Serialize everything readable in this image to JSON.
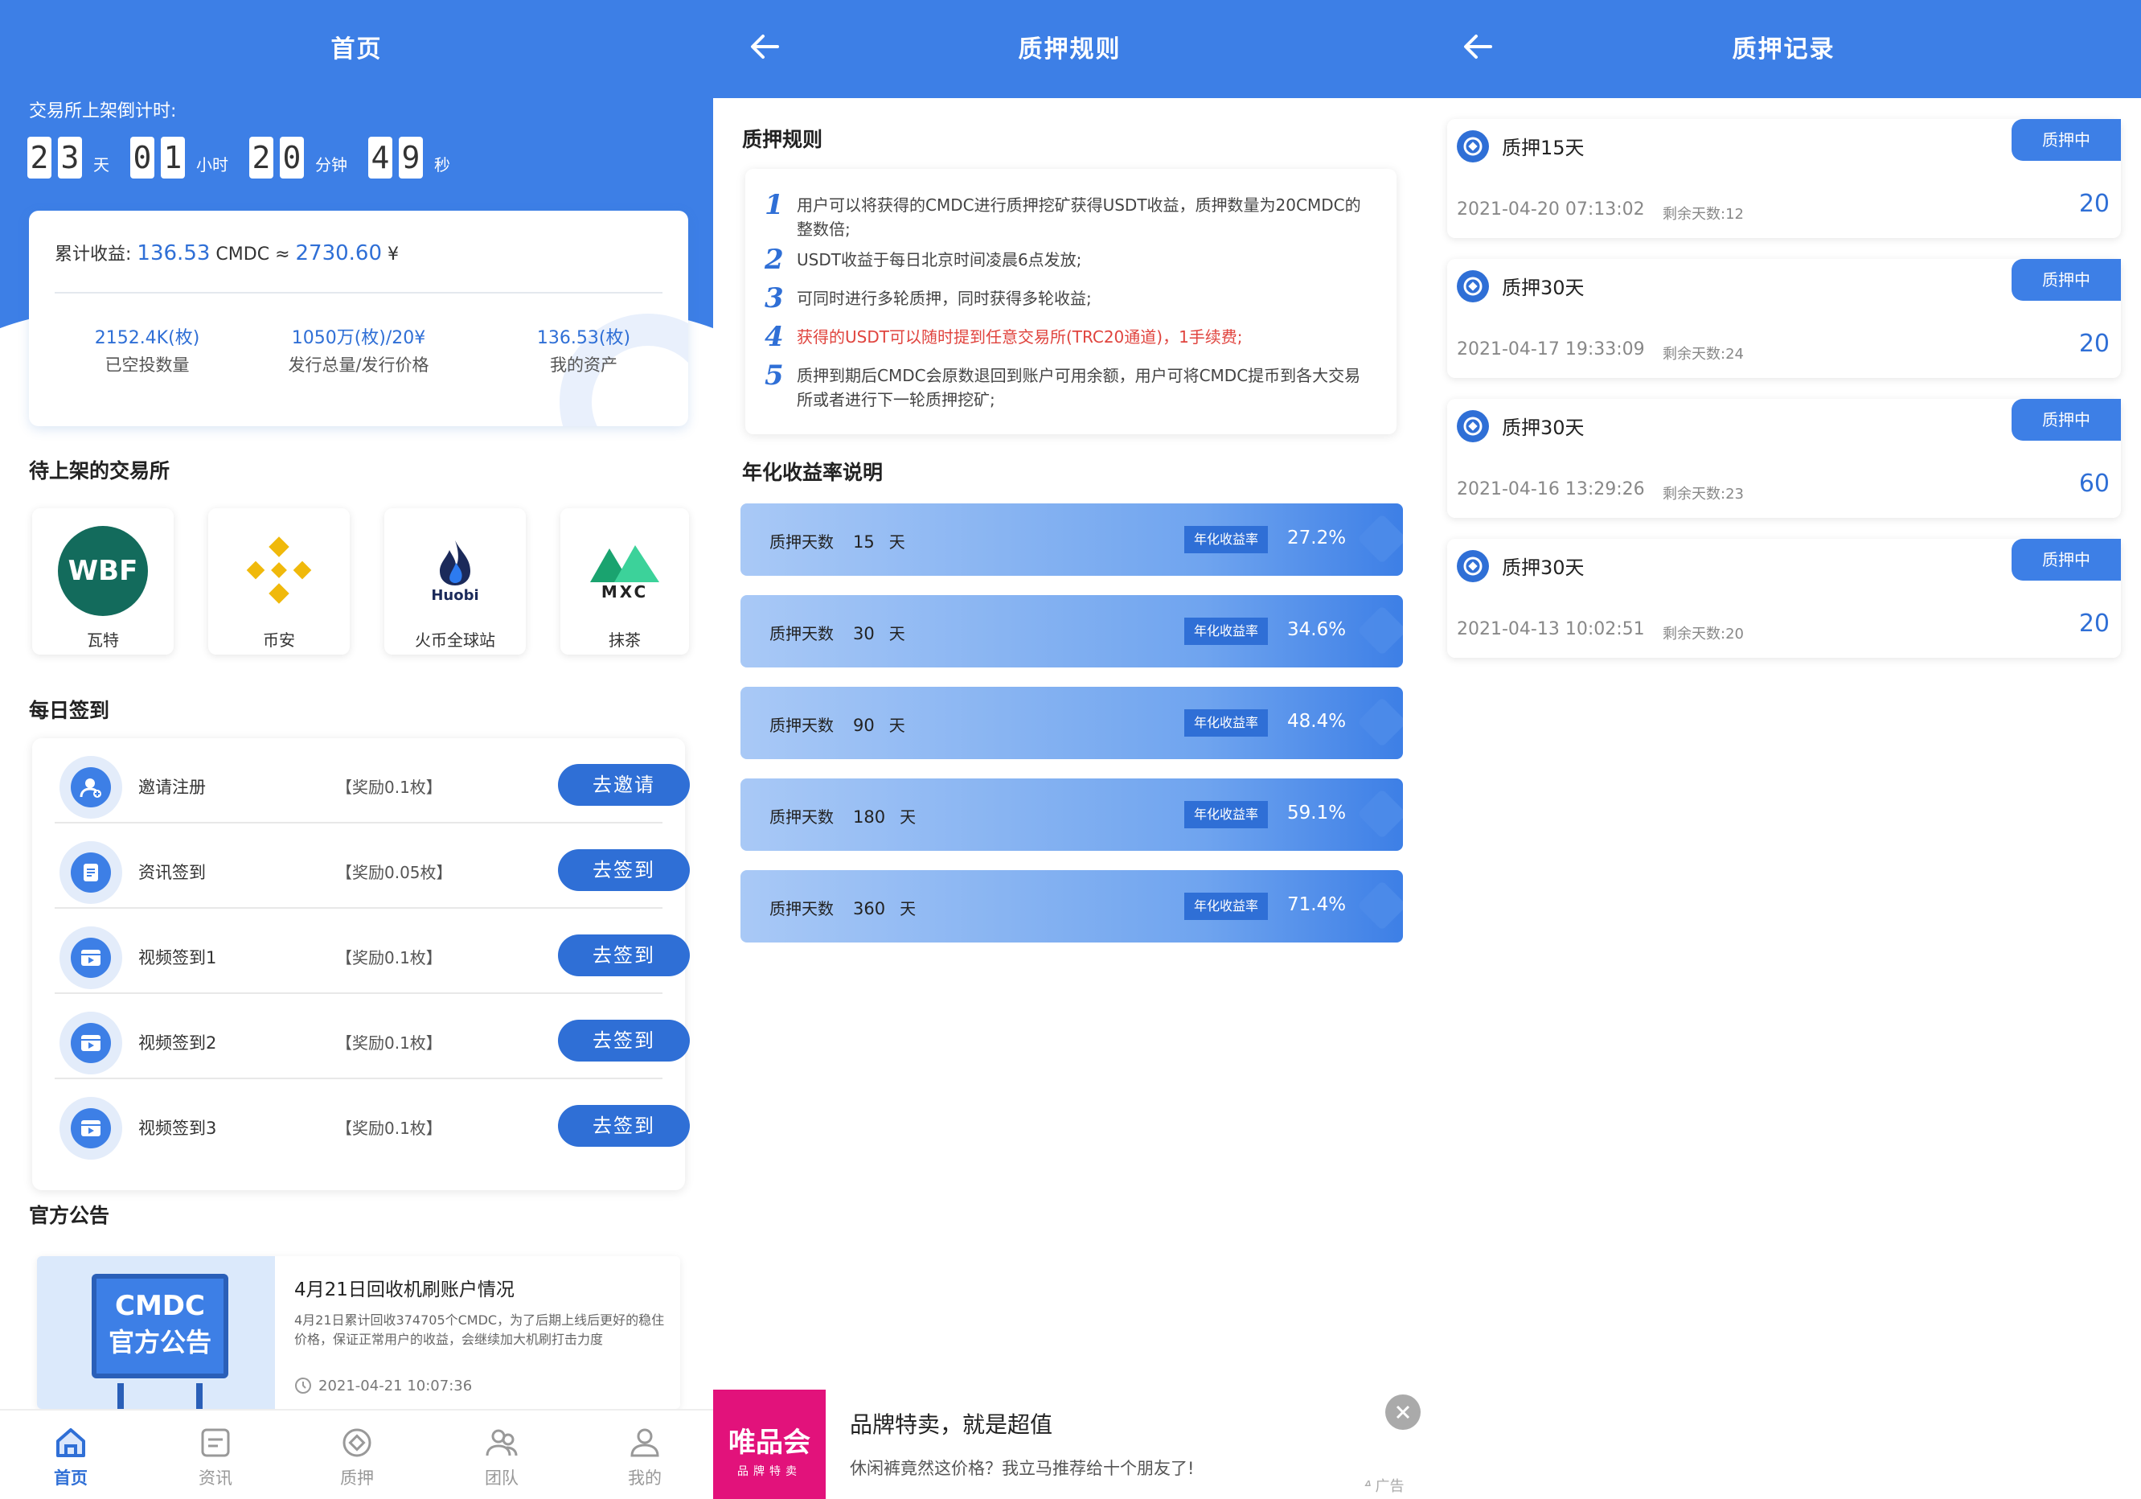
{
  "home": {
    "title": "首页",
    "countdown_label": "交易所上架倒计时:",
    "countdown": {
      "days_digits": [
        "2",
        "3"
      ],
      "days_unit": "天",
      "hours_digits": [
        "0",
        "1"
      ],
      "hours_unit": "小时",
      "minutes_digits": [
        "2",
        "0"
      ],
      "minutes_unit": "分钟",
      "seconds_digits": [
        "4",
        "9"
      ],
      "seconds_unit": "秒"
    },
    "earnings": {
      "label": "累计收益:",
      "cmdc_value": "136.53",
      "cmdc_unit": "CMDC",
      "approx": "≈",
      "cny_value": "2730.60",
      "cny_unit": "¥"
    },
    "stats": [
      {
        "value": "2152.4K(枚)",
        "label": "已空投数量"
      },
      {
        "value": "1050万(枚)/20¥",
        "label": "发行总量/发行价格"
      },
      {
        "value": "136.53(枚)",
        "label": "我的资产"
      }
    ],
    "exchanges_title": "待上架的交易所",
    "exchanges": [
      {
        "name": "瓦特",
        "logo_text": "WBF",
        "icon": "wbf-logo"
      },
      {
        "name": "币安",
        "icon": "binance-logo"
      },
      {
        "name": "火币全球站",
        "logo_text": "Huobi",
        "icon": "huobi-logo"
      },
      {
        "name": "抹茶",
        "logo_text": "MXC",
        "icon": "mxc-logo"
      }
    ],
    "checkin_title": "每日签到",
    "checkins": [
      {
        "name": "邀请注册",
        "reward": "【奖励0.1枚】",
        "button": "去邀请",
        "icon": "user-add-icon"
      },
      {
        "name": "资讯签到",
        "reward": "【奖励0.05枚】",
        "button": "去签到",
        "icon": "news-icon"
      },
      {
        "name": "视频签到1",
        "reward": "【奖励0.1枚】",
        "button": "去签到",
        "icon": "video-icon"
      },
      {
        "name": "视频签到2",
        "reward": "【奖励0.1枚】",
        "button": "去签到",
        "icon": "video-icon"
      },
      {
        "name": "视频签到3",
        "reward": "【奖励0.1枚】",
        "button": "去签到",
        "icon": "video-icon"
      }
    ],
    "notice_title": "官方公告",
    "notice": {
      "img_line1": "CMDC",
      "img_line2": "官方公告",
      "title": "4月21日回收机刷账户情况",
      "body": "4月21日累计回收374705个CMDC，为了后期上线后更好的稳住价格，保证正常用户的收益，会继续加大机刷打击力度",
      "time": "2021-04-21 10:07:36"
    },
    "tabs": [
      {
        "label": "首页",
        "icon": "home-icon"
      },
      {
        "label": "资讯",
        "icon": "news-icon"
      },
      {
        "label": "质押",
        "icon": "pledge-icon"
      },
      {
        "label": "团队",
        "icon": "team-icon"
      },
      {
        "label": "我的",
        "icon": "profile-icon"
      }
    ]
  },
  "rules": {
    "title": "质押规则",
    "section_title": "质押规则",
    "items": [
      {
        "n": "1",
        "text": "用户可以将获得的CMDC进行质押挖矿获得USDT收益，质押数量为20CMDC的整数倍;"
      },
      {
        "n": "2",
        "text": "USDT收益于每日北京时间凌晨6点发放;"
      },
      {
        "n": "3",
        "text": "可同时进行多轮质押，同时获得多轮收益;"
      },
      {
        "n": "4",
        "text": "获得的USDT可以随时提到任意交易所(TRC20通道)，1手续费;"
      },
      {
        "n": "5",
        "text": "质押到期后CMDC会原数退回到账户可用余额，用户可将CMDC提币到各大交易所或者进行下一轮质押挖矿;"
      }
    ],
    "rate_title": "年化收益率说明",
    "rate_label": "质押天数",
    "rate_day_unit": "天",
    "rate_tag": "年化收益率",
    "rates": [
      {
        "days": "15",
        "rate": "27.2%"
      },
      {
        "days": "30",
        "rate": "34.6%"
      },
      {
        "days": "90",
        "rate": "48.4%"
      },
      {
        "days": "180",
        "rate": "59.1%"
      },
      {
        "days": "360",
        "rate": "71.4%"
      }
    ],
    "ad": {
      "logo_line1": "唯品会",
      "logo_line2": "品牌特卖",
      "title": "品牌特卖，就是超值",
      "body": "休闲裤竟然这价格？我立马推荐给十个朋友了!",
      "mark": "广告"
    }
  },
  "records": {
    "title": "质押记录",
    "items": [
      {
        "title": "质押15天",
        "status": "质押中",
        "time": "2021-04-20 07:13:02",
        "days": "剩余天数:12",
        "amount": "20"
      },
      {
        "title": "质押30天",
        "status": "质押中",
        "time": "2021-04-17 19:33:09",
        "days": "剩余天数:24",
        "amount": "20"
      },
      {
        "title": "质押30天",
        "status": "质押中",
        "time": "2021-04-16 13:29:26",
        "days": "剩余天数:23",
        "amount": "60"
      },
      {
        "title": "质押30天",
        "status": "质押中",
        "time": "2021-04-13 10:02:51",
        "days": "剩余天数:20",
        "amount": "20"
      }
    ]
  },
  "colors": {
    "primary": "#3d7fe6",
    "accent": "#2f6fd6",
    "highlight": "#e0443e",
    "ad_brand": "#e2127b"
  }
}
